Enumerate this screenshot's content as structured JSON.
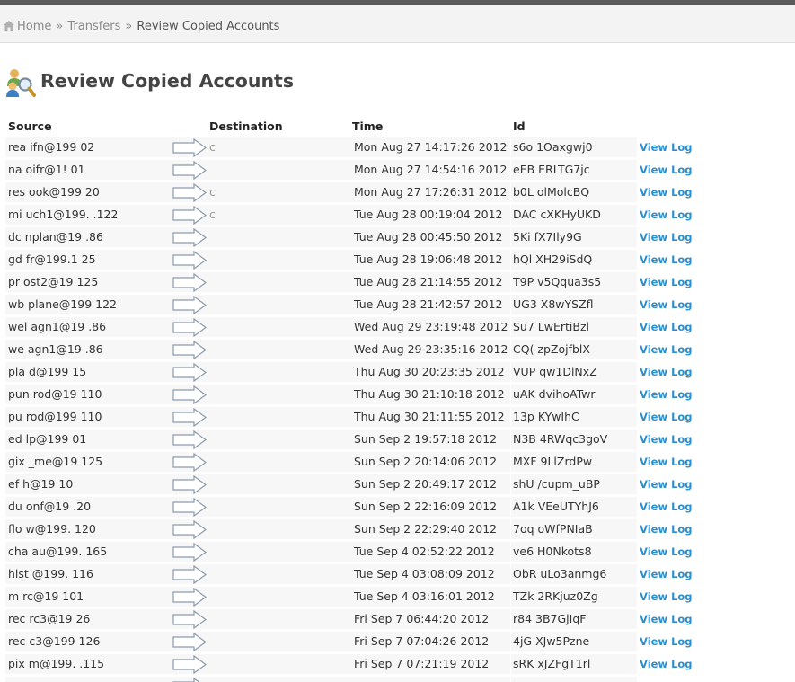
{
  "breadcrumb": {
    "home": "Home",
    "transfers": "Transfers",
    "separator": "»",
    "current": "Review Copied Accounts"
  },
  "page": {
    "title": "Review Copied Accounts"
  },
  "table": {
    "columns": {
      "source": "Source",
      "destination": "Destination",
      "time": "Time",
      "id": "Id"
    },
    "view_log_label": "View Log",
    "rows": [
      {
        "source": "rea    ifn@199              02",
        "destination": "c",
        "time": "Mon Aug 27 14:17:26 2012",
        "id": "s6o          1Oaxgwj0"
      },
      {
        "source": "na    oifr@1!               01",
        "destination": "",
        "time": "Mon Aug 27 14:54:16 2012",
        "id": "eEB          ERLTG7jc"
      },
      {
        "source": "res    ook@199              20",
        "destination": "c",
        "time": "Mon Aug 27 17:26:31 2012",
        "id": "b0L          olMolcBQ"
      },
      {
        "source": "mi    uch1@199.           .122",
        "destination": "c",
        "time": "Tue Aug 28 00:19:04 2012",
        "id": "DAC          cXKHyUKD"
      },
      {
        "source": "dc    nplan@19              .86",
        "destination": "",
        "time": "Tue Aug 28 00:45:50 2012",
        "id": "5Ki          fX7Ily9G"
      },
      {
        "source": "gd    fr@199.1           25",
        "destination": "",
        "time": "Tue Aug 28 19:06:48 2012",
        "id": "hQl          XH29iSdQ"
      },
      {
        "source": "pr    ost2@19               125",
        "destination": "",
        "time": "Tue Aug 28 21:14:55 2012",
        "id": "T9P          v5Qqua3s5"
      },
      {
        "source": "wb    plane@199             122",
        "destination": "",
        "time": "Tue Aug 28 21:42:57 2012",
        "id": "UG3          X8wYSZfl"
      },
      {
        "source": "wel    agn1@19               .86",
        "destination": "",
        "time": "Wed Aug 29 23:19:48 2012",
        "id": "Su7          LwErtiBzl"
      },
      {
        "source": "we    agn1@19               .86",
        "destination": "",
        "time": "Wed Aug 29 23:35:16 2012",
        "id": "CQ(          zpZojfblX"
      },
      {
        "source": "pla    d@199                15",
        "destination": "",
        "time": "Thu Aug 30 20:23:35 2012",
        "id": "VUP          qw1DlNxZ"
      },
      {
        "source": "pun    rod@19               110",
        "destination": "",
        "time": "Thu Aug 30 21:10:18 2012",
        "id": "uAK          dvihoATwr"
      },
      {
        "source": "pu    rod@199              110",
        "destination": "",
        "time": "Thu Aug 30 21:11:55 2012",
        "id": "13p          KYwIhC"
      },
      {
        "source": "ed    lp@199               01",
        "destination": "",
        "time": "Sun Sep 2 19:57:18 2012",
        "id": "N3B          4RWqc3goV"
      },
      {
        "source": "gix    _me@19              125",
        "destination": "",
        "time": "Sun Sep 2 20:14:06 2012",
        "id": "MXF          9LlZrdPw"
      },
      {
        "source": "ef    h@19                10",
        "destination": "",
        "time": "Sun Sep 2 20:49:17 2012",
        "id": "shU          /cupm_uBP"
      },
      {
        "source": "du    onf@19               .20",
        "destination": "",
        "time": "Sun Sep 2 22:16:09 2012",
        "id": "A1k          VEeUTYhJ6"
      },
      {
        "source": "flo    w@199.              120",
        "destination": "",
        "time": "Sun Sep 2 22:29:40 2012",
        "id": "7oq          oWfPNIaB"
      },
      {
        "source": "cha    au@199.             165",
        "destination": "",
        "time": "Tue Sep 4 02:52:22 2012",
        "id": "ve6          H0Nkots8"
      },
      {
        "source": "hist    @199.            116",
        "destination": "",
        "time": "Tue Sep 4 03:08:09 2012",
        "id": "ObR          uLo3anmg6"
      },
      {
        "source": "m    rc@19                101",
        "destination": "",
        "time": "Tue Sep 4 03:16:01 2012",
        "id": "TZk          2RKjuz0Zg"
      },
      {
        "source": "rec    rc3@19              26",
        "destination": "",
        "time": "Fri Sep 7 06:44:20 2012",
        "id": "r84          3B7GjIqF"
      },
      {
        "source": "rec    c3@199              126",
        "destination": "",
        "time": "Fri Sep 7 07:04:26 2012",
        "id": "4jG          XJw5Pzne"
      },
      {
        "source": "pix    m@199.           .115",
        "destination": "",
        "time": "Fri Sep 7 07:21:19 2012",
        "id": "sRK          xJZFgT1rl"
      }
    ]
  },
  "colors": {
    "link": "#2a8fd0",
    "topbar": "#5b5b5b",
    "crumbbar": "#f3f3f3"
  },
  "icons": {
    "home": "home-icon",
    "title": "users-search-icon",
    "row": "right-arrow-icon"
  }
}
